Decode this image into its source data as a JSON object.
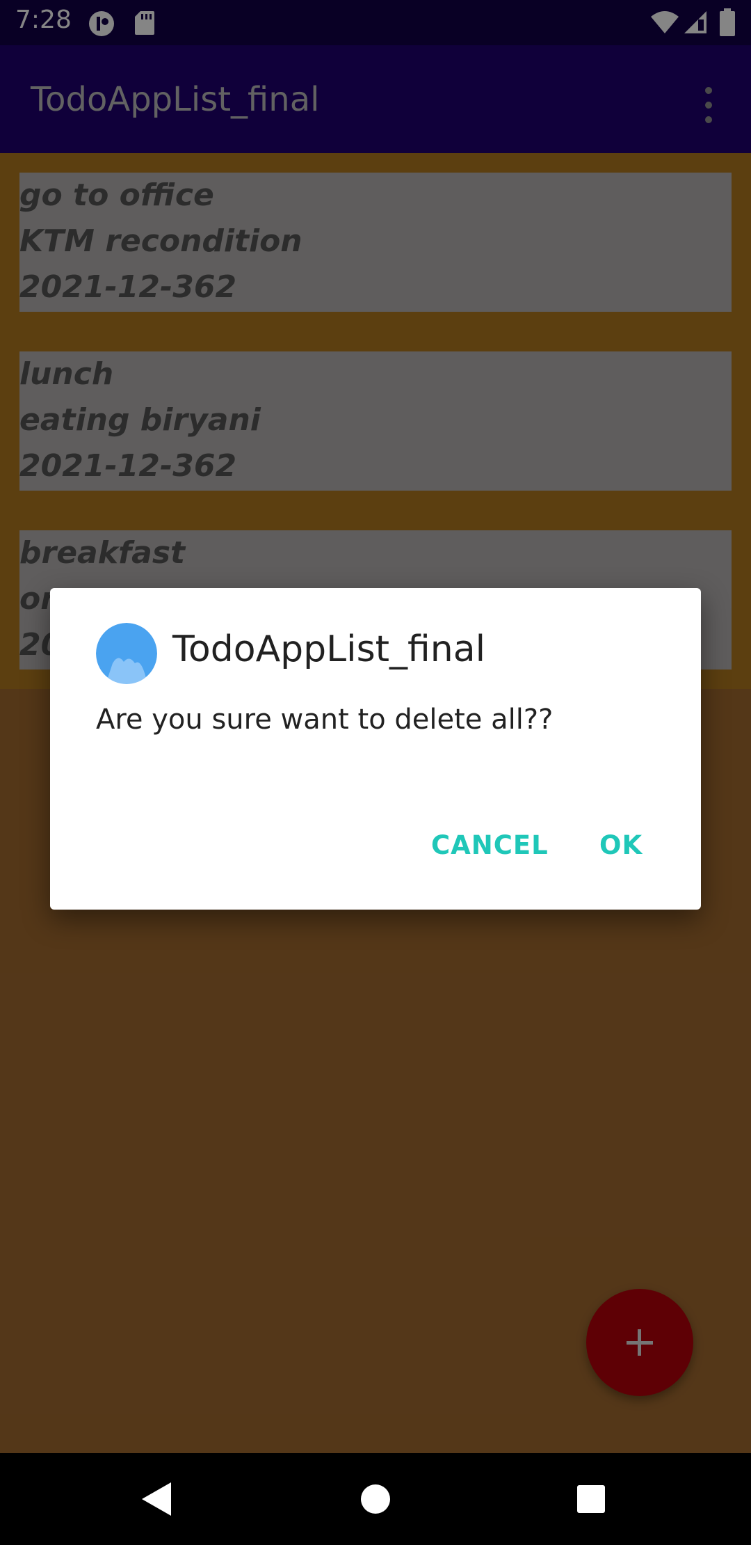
{
  "status_bar": {
    "time": "7:28",
    "icons": [
      "app-notification-icon",
      "sd-card-icon",
      "wifi-icon",
      "signal-icon",
      "battery-icon"
    ]
  },
  "app_bar": {
    "title": "TodoAppList_final",
    "menu_icon": "more-vert-icon"
  },
  "todos": [
    {
      "title": "go to office",
      "description": "KTM recondition",
      "date": "2021-12-362"
    },
    {
      "title": "lunch",
      "description": "eating biryani",
      "date": "2021-12-362"
    },
    {
      "title": "breakfast",
      "description": "or",
      "date": "20"
    }
  ],
  "dialog": {
    "title": "TodoAppList_final",
    "message": "Are you sure want to delete all??",
    "cancel_label": "CANCEL",
    "ok_label": "OK",
    "icon": "app-logo-icon"
  },
  "fab": {
    "icon": "plus-icon"
  },
  "nav_bar": {
    "icons": [
      "back-icon",
      "home-icon",
      "recents-icon"
    ]
  },
  "colors": {
    "status_bar": "#120047",
    "app_bar": "#1f0170",
    "list_background": "#b07a1f",
    "card": "#b6b3b2",
    "content_background": "#a16a2f",
    "fab": "#b5000b",
    "dialog_button": "#1fc7b8"
  }
}
